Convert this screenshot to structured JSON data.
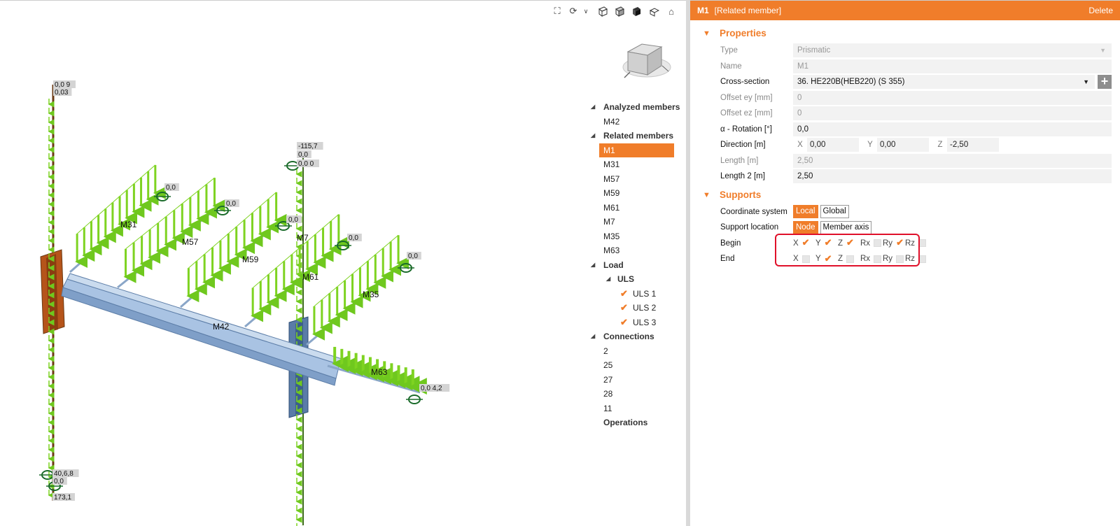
{
  "toolbar": {
    "icons": [
      "fullscreen-icon",
      "rotate-icon",
      "chevron-down-icon",
      "wireframe-cube-icon",
      "transparent-cube-icon",
      "solid-cube-icon",
      "view-front-icon",
      "home-icon"
    ]
  },
  "model": {
    "member_labels": [
      "M31",
      "M57",
      "M59",
      "M7",
      "M61",
      "M35",
      "M42",
      "M63"
    ],
    "value_labels": [
      "0,0 9",
      "0,03",
      "-115,7",
      "0,0",
      "0,0 0",
      "0,0",
      "0,0",
      "0,0",
      "0,0",
      "0,0",
      "0,0",
      "0,0 4,2",
      "40,6,8",
      "0,0",
      "173,1"
    ]
  },
  "tree": {
    "analyzed_members_label": "Analyzed members",
    "analyzed_members": [
      "M42"
    ],
    "related_members_label": "Related members",
    "related_members": [
      "M1",
      "M31",
      "M57",
      "M59",
      "M61",
      "M7",
      "M35",
      "M63"
    ],
    "selected_member": "M1",
    "load_label": "Load",
    "uls_label": "ULS",
    "load_cases": [
      "ULS 1",
      "ULS 2",
      "ULS 3"
    ],
    "connections_label": "Connections",
    "connections": [
      "2",
      "25",
      "27",
      "28",
      "11"
    ],
    "operations_label": "Operations"
  },
  "panel": {
    "member": "M1",
    "subtitle": "[Related member]",
    "delete_label": "Delete",
    "properties_title": "Properties",
    "type_label": "Type",
    "type_value": "Prismatic",
    "name_label": "Name",
    "name_value": "M1",
    "cross_section_label": "Cross-section",
    "cross_section_value": "36. HE220B(HEB220) (S 355)",
    "offset_ey_label": "Offset ey [mm]",
    "offset_ey_value": "0",
    "offset_ez_label": "Offset ez [mm]",
    "offset_ez_value": "0",
    "rotation_label": "α - Rotation [°]",
    "rotation_value": "0,0",
    "direction_label": "Direction [m]",
    "direction": {
      "x_label": "X",
      "x": "0,00",
      "y_label": "Y",
      "y": "0,00",
      "z_label": "Z",
      "z": "-2,50"
    },
    "length_label": "Length [m]",
    "length_value": "2,50",
    "length2_label": "Length 2 [m]",
    "length2_value": "2,50",
    "supports_title": "Supports",
    "coord_system_label": "Coordinate system",
    "coord_local": "Local",
    "coord_global": "Global",
    "coord_selected": "Local",
    "support_location_label": "Support location",
    "loc_node": "Node",
    "loc_member_axis": "Member axis",
    "loc_selected": "Node",
    "begin_label": "Begin",
    "end_label": "End",
    "dof_labels": [
      "X",
      "Y",
      "Z",
      "Rx",
      "Ry",
      "Rz"
    ],
    "begin_checked": [
      true,
      true,
      true,
      false,
      true,
      false
    ],
    "end_checked": [
      false,
      true,
      false,
      false,
      false,
      false
    ]
  },
  "colors": {
    "accent": "#f07d2a",
    "highlight": "#e0102a",
    "load": "#7ed321",
    "beam": "#8fb0d6",
    "column": "#b5541a"
  }
}
